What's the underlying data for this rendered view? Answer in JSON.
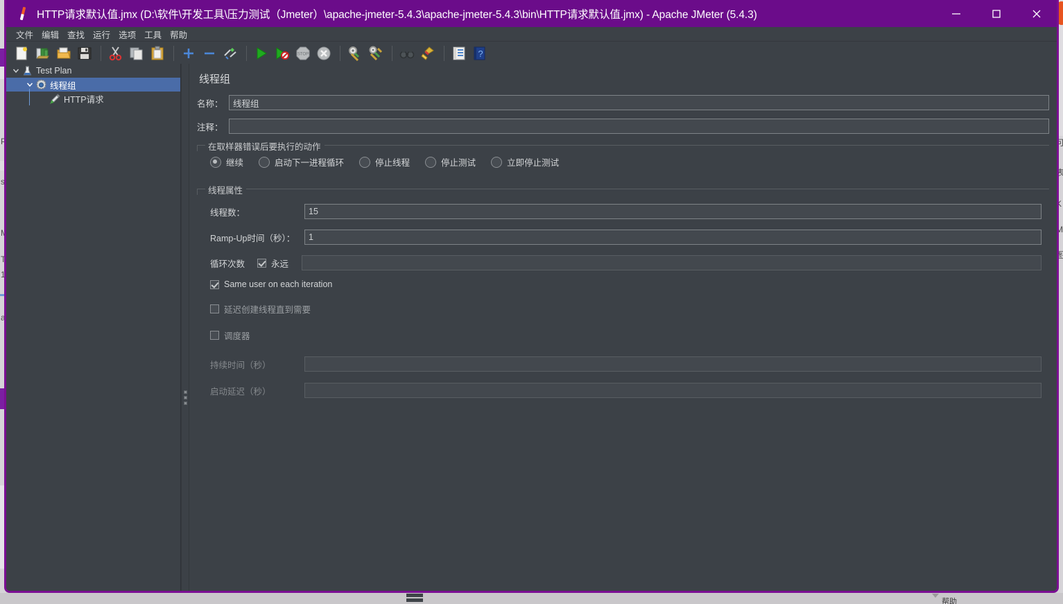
{
  "window": {
    "title": "HTTP请求默认值.jmx (D:\\软件\\开发工具\\压力测试（Jmeter）\\apache-jmeter-5.4.3\\apache-jmeter-5.4.3\\bin\\HTTP请求默认值.jmx) - Apache JMeter (5.4.3)",
    "app_icon": "jmeter-feather-icon",
    "titlebar_color": "#6b0c8a",
    "border_color": "#7b0f93",
    "controls": {
      "minimize": "minimize-icon",
      "maximize": "maximize-icon",
      "close": "close-icon"
    }
  },
  "menubar": {
    "items": [
      {
        "label": "文件",
        "name": "menu-file"
      },
      {
        "label": "编辑",
        "name": "menu-edit"
      },
      {
        "label": "查找",
        "name": "menu-search"
      },
      {
        "label": "运行",
        "name": "menu-run"
      },
      {
        "label": "选项",
        "name": "menu-options"
      },
      {
        "label": "工具",
        "name": "menu-tools"
      },
      {
        "label": "帮助",
        "name": "menu-help"
      }
    ]
  },
  "toolbar": {
    "buttons": [
      {
        "icon": "new-file-icon",
        "name": "toolbar-new"
      },
      {
        "icon": "templates-icon",
        "name": "toolbar-templates"
      },
      {
        "icon": "open-folder-icon",
        "name": "toolbar-open"
      },
      {
        "icon": "save-floppy-icon",
        "name": "toolbar-save"
      },
      {
        "icon": "cut-scissors-icon",
        "name": "toolbar-cut"
      },
      {
        "icon": "copy-icon",
        "name": "toolbar-copy"
      },
      {
        "icon": "paste-clipboard-icon",
        "name": "toolbar-paste"
      },
      {
        "icon": "plus-icon",
        "name": "toolbar-expand"
      },
      {
        "icon": "minus-icon",
        "name": "toolbar-collapse"
      },
      {
        "icon": "toggle-icon",
        "name": "toolbar-toggle"
      },
      {
        "icon": "start-play-icon",
        "name": "toolbar-start"
      },
      {
        "icon": "start-no-timers-icon",
        "name": "toolbar-start-no-pauses"
      },
      {
        "icon": "stop-icon",
        "name": "toolbar-stop"
      },
      {
        "icon": "shutdown-icon",
        "name": "toolbar-shutdown"
      },
      {
        "icon": "clear-icon",
        "name": "toolbar-clear"
      },
      {
        "icon": "clear-all-icon",
        "name": "toolbar-clear-all"
      },
      {
        "icon": "binoculars-search-icon",
        "name": "toolbar-search"
      },
      {
        "icon": "broom-reset-icon",
        "name": "toolbar-reset-search"
      },
      {
        "icon": "function-helper-icon",
        "name": "toolbar-function-helper"
      },
      {
        "icon": "help-book-icon",
        "name": "toolbar-help"
      }
    ]
  },
  "tree": {
    "nodes": [
      {
        "label": "Test Plan",
        "icon": "test-plan-icon",
        "depth": 0,
        "selected": false,
        "expanded": true
      },
      {
        "label": "线程组",
        "icon": "thread-group-gear-icon",
        "depth": 1,
        "selected": true,
        "expanded": true
      },
      {
        "label": "HTTP请求",
        "icon": "http-request-pen-icon",
        "depth": 2,
        "selected": false,
        "expanded": null
      }
    ],
    "selection_color": "#4a6ca8"
  },
  "main": {
    "title": "线程组",
    "name_label": "名称：",
    "name_value": "线程组",
    "comment_label": "注释：",
    "comment_value": "",
    "error_action": {
      "legend": "在取样器错误后要执行的动作",
      "options": [
        {
          "label": "继续",
          "selected": true
        },
        {
          "label": "启动下一进程循环",
          "selected": false
        },
        {
          "label": "停止线程",
          "selected": false
        },
        {
          "label": "停止测试",
          "selected": false
        },
        {
          "label": "立即停止测试",
          "selected": false
        }
      ]
    },
    "thread_properties": {
      "legend": "线程属性",
      "num_threads_label": "线程数：",
      "num_threads_value": "15",
      "ramp_up_label": "Ramp-Up时间（秒）：",
      "ramp_up_value": "1",
      "loop_count_label": "循环次数",
      "forever_label": "永远",
      "forever_checked": true,
      "loop_count_value": "",
      "same_user_label": "Same user on each iteration",
      "same_user_checked": true,
      "delayed_start_label": "延迟创建线程直到需要",
      "delayed_start_checked": false,
      "scheduler_label": "调度器",
      "scheduler_checked": false,
      "duration_label": "持续时间（秒）",
      "duration_value": "",
      "duration_enabled": false,
      "startup_delay_label": "启动延迟（秒）",
      "startup_delay_value": "",
      "startup_delay_enabled": false
    }
  },
  "background": {
    "left_fragments": [
      "P",
      "s",
      "M",
      "T",
      "1",
      "a"
    ],
    "right_fragments": [
      "可",
      "表",
      "K",
      "M",
      "图"
    ],
    "taskbar_label": "帮助"
  }
}
